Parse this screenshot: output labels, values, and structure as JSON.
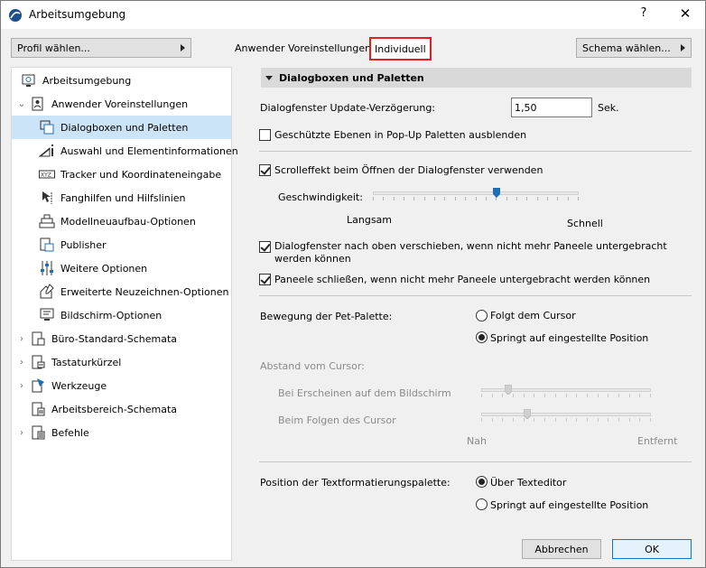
{
  "window": {
    "title": "Arbeitsumgebung",
    "help_glyph": "?",
    "close_glyph": "✕"
  },
  "header": {
    "profile_button": "Profil wählen...",
    "pref_label": "Anwender Voreinstellungen :",
    "pref_value": "Individuell",
    "schema_button": "Schema wählen..."
  },
  "tree": {
    "items": [
      {
        "label": "Arbeitsumgebung",
        "icon": "work-environment-icon"
      },
      {
        "label": "Anwender Voreinstellungen",
        "icon": "user-prefs-icon",
        "expanded": true
      },
      {
        "label": "Dialogboxen und Paletten",
        "icon": "dialog-palettes-icon",
        "selected": true
      },
      {
        "label": "Auswahl und Elementinformationen",
        "icon": "selection-info-icon"
      },
      {
        "label": "Tracker und Koordinateneingabe",
        "icon": "tracker-xyz-icon"
      },
      {
        "label": "Fanghilfen und Hilfslinien",
        "icon": "snap-guides-icon"
      },
      {
        "label": "Modellneuaufbau-Optionen",
        "icon": "model-rebuild-icon"
      },
      {
        "label": "Publisher",
        "icon": "publisher-icon"
      },
      {
        "label": "Weitere Optionen",
        "icon": "more-options-icon"
      },
      {
        "label": "Erweiterte Neuzeichnen-Optionen",
        "icon": "redraw-options-icon"
      },
      {
        "label": "Bildschirm-Optionen",
        "icon": "screen-options-icon"
      },
      {
        "label": "Büro-Standard-Schemata",
        "icon": "office-schemes-icon"
      },
      {
        "label": "Tastaturkürzel",
        "icon": "keyboard-shortcuts-icon"
      },
      {
        "label": "Werkzeuge",
        "icon": "tools-icon"
      },
      {
        "label": "Arbeitsbereich-Schemata",
        "icon": "workspace-schemes-icon"
      },
      {
        "label": "Befehle",
        "icon": "commands-icon"
      }
    ]
  },
  "panel": {
    "section_title": "Dialogboxen und Paletten",
    "update_delay_label": "Dialogfenster Update-Verzögerung:",
    "update_delay_value": "1,50",
    "update_delay_unit": "Sek.",
    "hide_protected_layers": "Geschützte Ebenen in Pop-Up Paletten ausblenden",
    "scroll_effect": "Scrolleffekt beim Öffnen der Dialogfenster verwenden",
    "speed_label": "Geschwindigkeit:",
    "speed_slow": "Langsam",
    "speed_fast": "Schnell",
    "speed_level": 0.6,
    "move_up": "Dialogfenster nach oben verschieben, wenn nicht mehr Paneele untergebracht werden können",
    "close_panels": "Paneele schließen, wenn nicht mehr Paneele untergebracht werden können",
    "pet_label": "Bewegung der Pet-Palette:",
    "pet_follow": "Folgt dem Cursor",
    "pet_jump": "Springt auf eingestellte Position",
    "cursor_distance": "Abstand vom Cursor:",
    "appear_label": "Bei Erscheinen auf dem Bildschirm",
    "follow_label": "Beim Folgen des Cursor",
    "near": "Nah",
    "far": "Entfernt",
    "appear_level": 0.16,
    "follow_level": 0.27,
    "text_palette_label": "Position der Textformatierungspalette:",
    "text_over_editor": "Über Texteditor",
    "text_jump": "Springt auf eingestellte Position"
  },
  "footer": {
    "cancel": "Abbrechen",
    "ok": "OK"
  }
}
